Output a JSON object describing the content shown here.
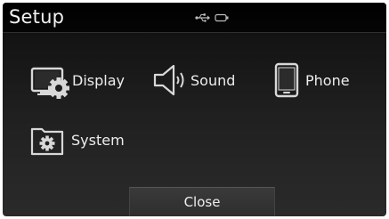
{
  "header": {
    "title": "Setup",
    "status_icons": [
      "usb-icon",
      "battery-icon"
    ]
  },
  "menu": {
    "items": [
      {
        "label": "Display",
        "icon": "display-settings-icon"
      },
      {
        "label": "Sound",
        "icon": "speaker-icon"
      },
      {
        "label": "Phone",
        "icon": "phone-icon"
      },
      {
        "label": "System",
        "icon": "system-folder-gear-icon"
      }
    ]
  },
  "footer": {
    "close_label": "Close"
  },
  "colors": {
    "background": "#1f1f1f",
    "titlebar": "#000000",
    "text": "#ececec",
    "button": "#353535"
  }
}
